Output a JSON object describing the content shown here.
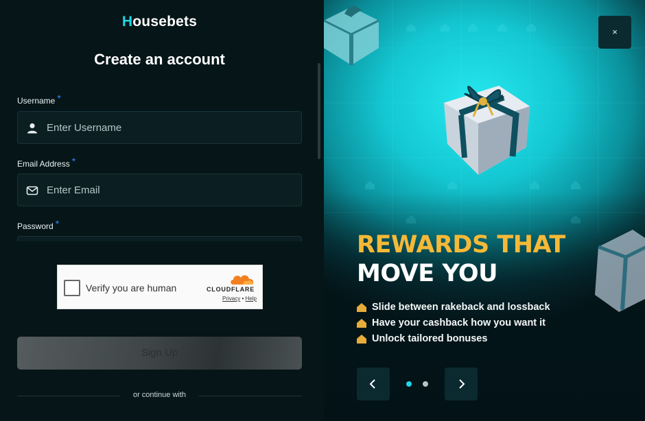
{
  "brand": {
    "logo_first": "H",
    "logo_rest": "ousebets",
    "accent": "#1ed6e6"
  },
  "form": {
    "title": "Create an account",
    "username": {
      "label": "Username",
      "required": "*",
      "placeholder": "Enter Username",
      "icon": "user-icon"
    },
    "email": {
      "label": "Email Address",
      "required": "*",
      "placeholder": "Enter Email",
      "icon": "mail-icon"
    },
    "password": {
      "label": "Password",
      "required": "*"
    },
    "captcha": {
      "text": "Verify you are human",
      "provider": "CLOUDFLARE",
      "privacy": "Privacy",
      "sep": "•",
      "help": "Help"
    },
    "signup_label": "Sign Up",
    "divider_text": "or continue with"
  },
  "promo": {
    "close_label": "×",
    "headline_line1": "REWARDS THAT",
    "headline_line2": "MOVE YOU",
    "headline_gold": "#f6b937",
    "bullets": [
      "Slide between rakeback and lossback",
      "Have your cashback how you want it",
      "Unlock tailored bonuses"
    ],
    "carousel": {
      "active_index": 0,
      "count": 2,
      "active_color": "#1ed6e6",
      "inactive_color": "#b8c4c6"
    }
  }
}
